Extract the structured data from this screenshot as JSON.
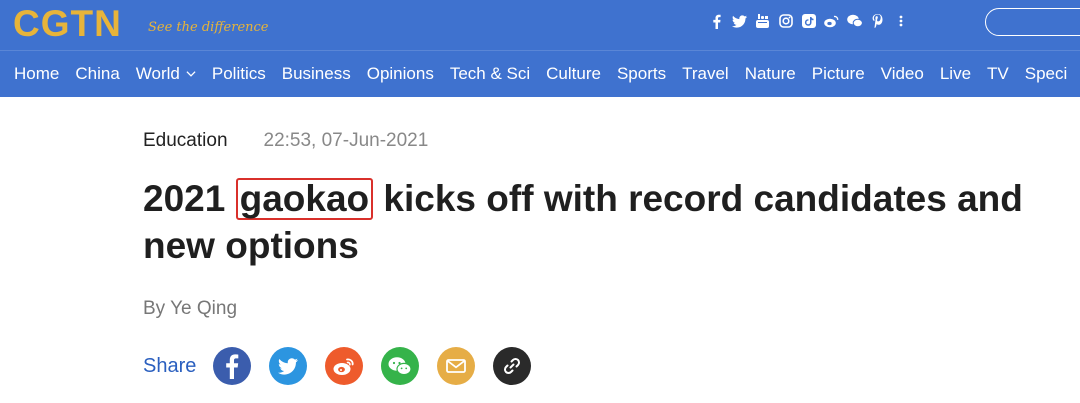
{
  "header": {
    "logo_text": "CGTN",
    "tagline": "See the difference",
    "social_icons": [
      "facebook-icon",
      "twitter-icon",
      "youtube-icon",
      "instagram-icon",
      "tiktok-icon",
      "weibo-icon",
      "wechat-icon",
      "pinterest-icon",
      "more-icon"
    ],
    "colors": {
      "bar": "#3f72cf",
      "logo": "#e7b43a"
    }
  },
  "nav": {
    "items": [
      {
        "label": "Home"
      },
      {
        "label": "China"
      },
      {
        "label": "World",
        "has_dropdown": true
      },
      {
        "label": "Politics"
      },
      {
        "label": "Business"
      },
      {
        "label": "Opinions"
      },
      {
        "label": "Tech & Sci"
      },
      {
        "label": "Culture"
      },
      {
        "label": "Sports"
      },
      {
        "label": "Travel"
      },
      {
        "label": "Nature"
      },
      {
        "label": "Picture"
      },
      {
        "label": "Video"
      },
      {
        "label": "Live"
      },
      {
        "label": "TV"
      },
      {
        "label": "Speci"
      }
    ]
  },
  "article": {
    "category": "Education",
    "timestamp": "22:53, 07-Jun-2021",
    "headline_pre": "2021",
    "headline_highlight": "gaokao",
    "headline_post": "kicks off with record candidates and new options",
    "byline": "By Ye Qing",
    "highlight_color": "#d9302b"
  },
  "share": {
    "label": "Share",
    "icons": [
      {
        "name": "facebook-icon",
        "color": "#3b5dad"
      },
      {
        "name": "twitter-icon",
        "color": "#2c95e0"
      },
      {
        "name": "weibo-icon",
        "color": "#ee5b2c"
      },
      {
        "name": "wechat-icon",
        "color": "#35b34a"
      },
      {
        "name": "email-icon",
        "color": "#e6ad46"
      },
      {
        "name": "link-icon",
        "color": "#2a2a2a"
      }
    ]
  }
}
